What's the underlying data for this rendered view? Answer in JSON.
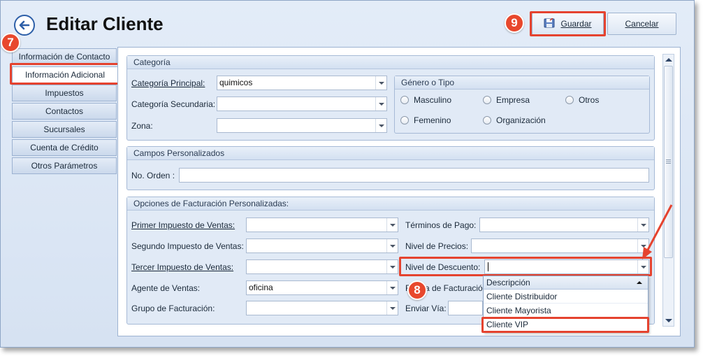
{
  "header": {
    "title": "Editar Cliente",
    "save_label": "Guardar",
    "cancel_label": "Cancelar"
  },
  "annotations": {
    "step7": "7",
    "step8": "8",
    "step9": "9"
  },
  "nav": {
    "items": [
      {
        "label": "Información de Contacto"
      },
      {
        "label": "Información Adicional"
      },
      {
        "label": "Impuestos"
      },
      {
        "label": "Contactos"
      },
      {
        "label": "Sucursales"
      },
      {
        "label": "Cuenta de Crédito"
      },
      {
        "label": "Otros Parámetros"
      }
    ]
  },
  "categoria": {
    "title": "Categoría",
    "principal_label": "Categoría Principal:",
    "principal_value": "quimicos",
    "secundaria_label": "Categoría Secundaria:",
    "secundaria_value": "",
    "zona_label": "Zona:",
    "zona_value": "",
    "genero": {
      "title": "Género o Tipo",
      "options": [
        "Masculino",
        "Empresa",
        "Otros",
        "Femenino",
        "Organización"
      ]
    }
  },
  "campos": {
    "title": "Campos Personalizados",
    "orden_label": "No. Orden :",
    "orden_value": ""
  },
  "facturacion": {
    "title": "Opciones de Facturación Personalizadas:",
    "primer_impuesto_label": "Primer Impuesto de Ventas:",
    "segundo_impuesto_label": "Segundo Impuesto de Ventas:",
    "tercer_impuesto_label": "Tercer Impuesto de Ventas:",
    "agente_label": "Agente de Ventas:",
    "agente_value": "oficina",
    "grupo_label": "Grupo de Facturación:",
    "terminos_label": "Términos de Pago:",
    "nivel_precios_label": "Nivel de Precios:",
    "nivel_descuento_label": "Nivel de Descuento:",
    "forma_facturacion_label": "Forma de Facturación:",
    "enviar_via_label": "Enviar Vía:"
  },
  "dropdown": {
    "header": "Descripción",
    "options": [
      "Cliente Distribuidor",
      "Cliente Mayorista",
      "Cliente VIP"
    ]
  },
  "colors": {
    "highlight": "#e5432f",
    "badge": "#e8482d",
    "accent": "#2d5fa8"
  }
}
